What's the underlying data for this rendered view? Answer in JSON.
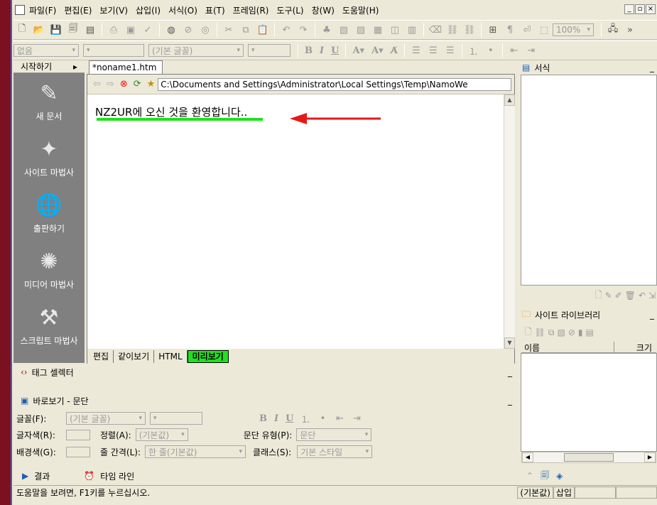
{
  "menu": [
    "파일(F)",
    "편집(E)",
    "보기(V)",
    "삽입(I)",
    "서식(O)",
    "표(T)",
    "프레임(R)",
    "도구(L)",
    "창(W)",
    "도움말(H)"
  ],
  "window_buttons": [
    "_",
    "▫",
    "×"
  ],
  "toolbar1": {
    "zoom": "100%"
  },
  "toolbar2": {
    "style_combo": "없음",
    "font_combo": "(기본 글꼴)"
  },
  "left_panel": {
    "title": "시작하기",
    "items": [
      {
        "label": "새 문서",
        "icon": "new-document-icon"
      },
      {
        "label": "사이트 마법사",
        "icon": "site-wizard-icon"
      },
      {
        "label": "출판하기",
        "icon": "publish-icon"
      },
      {
        "label": "미디어 마법사",
        "icon": "media-wizard-icon"
      },
      {
        "label": "스크립트 마법사",
        "icon": "script-wizard-icon"
      }
    ]
  },
  "document": {
    "tab_title": "*noname1.htm",
    "path": "C:\\Documents and Settings\\Administrator\\Local Settings\\Temp\\NamoWe",
    "welcome_text": "NZ2UR에 오신 것을 환영합니다..",
    "view_tabs": [
      "편집",
      "같이보기",
      "HTML",
      "미리보기"
    ]
  },
  "tag_selector": {
    "title": "태그 셀렉터"
  },
  "quick_view": {
    "title": "바로보기 - 문단",
    "font_label": "글꼴(F):",
    "font_value": "(기본 글꼴)",
    "font_color_label": "글자색(R):",
    "align_label": "정렬(A):",
    "align_value": "(기본값)",
    "para_type_label": "문단 유형(P):",
    "para_type_value": "문단",
    "bg_label": "배경색(G):",
    "line_spacing_label": "줄 간격(L):",
    "line_spacing_value": "한 줄(기본값)",
    "class_label": "클래스(S):",
    "class_value": "기본 스타일"
  },
  "bottom_tabs": [
    "결과",
    "타임 라인"
  ],
  "status": {
    "help_text": "도움말을 보려면, F1키를 누르십시오.",
    "default_cell": "(기본값)",
    "insert_cell": "삽입"
  },
  "right_panel": {
    "format_title": "서식",
    "library_title": "사이트 라이브러리",
    "col_name": "이름",
    "col_size": "크기"
  }
}
